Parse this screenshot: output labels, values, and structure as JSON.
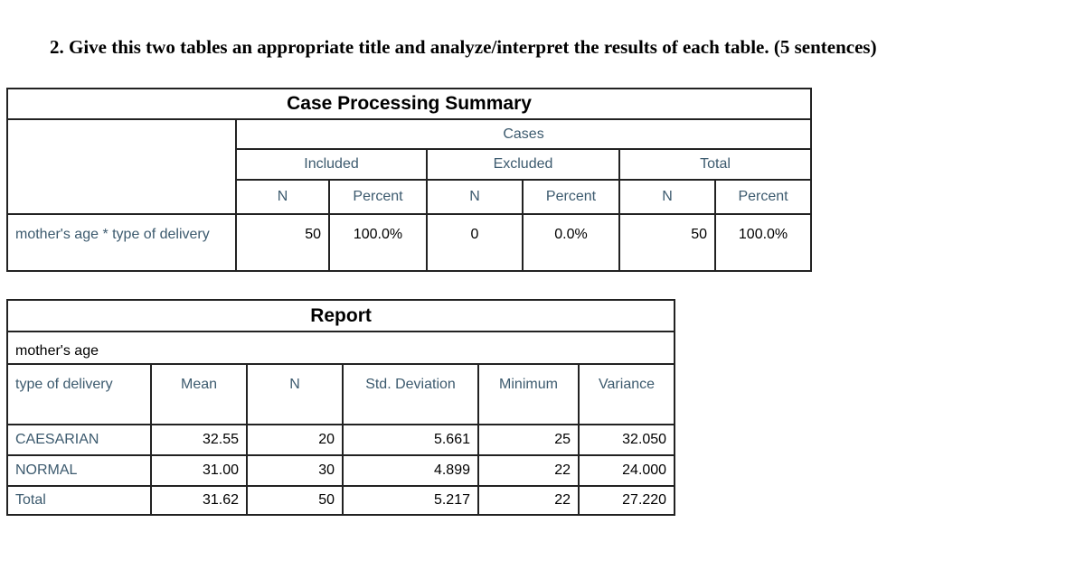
{
  "question": "2.  Give this two tables an appropriate title and analyze/interpret the results of each table.  (5 sentences)",
  "case_summary": {
    "title": "Case Processing Summary",
    "cases_label": "Cases",
    "groups": [
      "Included",
      "Excluded",
      "Total"
    ],
    "sub_headers": [
      "N",
      "Percent",
      "N",
      "Percent",
      "N",
      "Percent"
    ],
    "row_label": "mother's age  *  type of delivery",
    "values": [
      "50",
      "100.0%",
      "0",
      "0.0%",
      "50",
      "100.0%"
    ]
  },
  "report": {
    "title": "Report",
    "variable": "mother's age",
    "headers": [
      "type of delivery",
      "Mean",
      "N",
      "Std. Deviation",
      "Minimum",
      "Variance"
    ],
    "rows": [
      {
        "label": "CAESARIAN",
        "mean": "32.55",
        "n": "20",
        "sd": "5.661",
        "min": "25",
        "var": "32.050"
      },
      {
        "label": "NORMAL",
        "mean": "31.00",
        "n": "30",
        "sd": "4.899",
        "min": "22",
        "var": "24.000"
      },
      {
        "label": "Total",
        "mean": "31.62",
        "n": "50",
        "sd": "5.217",
        "min": "22",
        "var": "27.220"
      }
    ]
  }
}
